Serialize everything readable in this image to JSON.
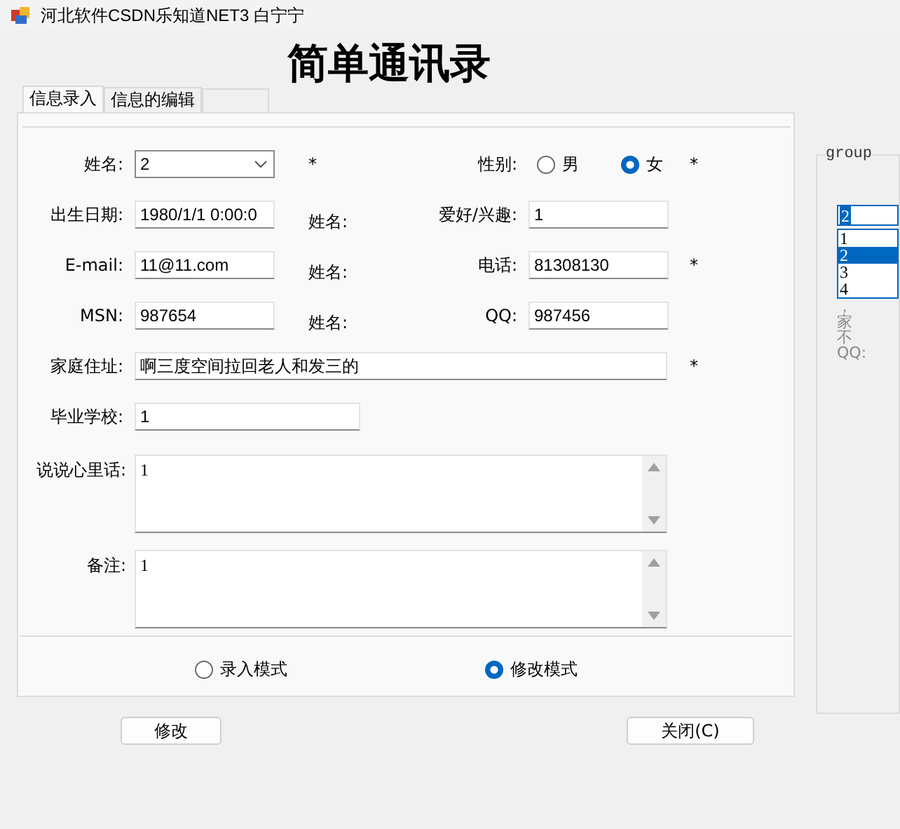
{
  "window": {
    "title": "河北软件CSDN乐知道NET3 白宁宁"
  },
  "heading": "简单通讯录",
  "tabs": [
    {
      "label": "信息录入",
      "selected": true
    },
    {
      "label": "信息的编辑",
      "selected": false
    }
  ],
  "form": {
    "rows": [
      {
        "items": [
          {
            "kind": "label",
            "text": "姓名:"
          },
          {
            "kind": "combo",
            "value": "2"
          },
          {
            "kind": "mark",
            "text": "*"
          },
          {
            "kind": "label",
            "text": "性别:"
          },
          {
            "kind": "radios",
            "options": [
              {
                "label": "男",
                "selected": false
              },
              {
                "label": "女",
                "selected": true
              }
            ]
          },
          {
            "kind": "mark",
            "text": "*"
          }
        ]
      },
      {
        "items": [
          {
            "kind": "label",
            "text": "出生日期:"
          },
          {
            "kind": "text",
            "value": "1980/1/1 0:00:0"
          },
          {
            "kind": "note",
            "text": "姓名:"
          },
          {
            "kind": "label",
            "text": "爱好/兴趣:"
          },
          {
            "kind": "text",
            "value": "1"
          }
        ]
      },
      {
        "items": [
          {
            "kind": "label",
            "text": "E-mail:"
          },
          {
            "kind": "text",
            "value": "11@11.com"
          },
          {
            "kind": "note",
            "text": "姓名:"
          },
          {
            "kind": "label",
            "text": "电话:"
          },
          {
            "kind": "text",
            "value": "81308130"
          },
          {
            "kind": "mark",
            "text": "*"
          }
        ]
      },
      {
        "items": [
          {
            "kind": "label",
            "text": "MSN:"
          },
          {
            "kind": "text",
            "value": "987654"
          },
          {
            "kind": "note",
            "text": "姓名:"
          },
          {
            "kind": "label",
            "text": "QQ:"
          },
          {
            "kind": "text",
            "value": "987456"
          }
        ]
      },
      {
        "items": [
          {
            "kind": "label",
            "text": "家庭住址:"
          },
          {
            "kind": "wide_text",
            "value": "啊三度空间拉回老人和发三的"
          },
          {
            "kind": "mark",
            "text": "*"
          }
        ]
      },
      {
        "items": [
          {
            "kind": "label",
            "text": "毕业学校:"
          },
          {
            "kind": "medium_text",
            "value": "1"
          }
        ]
      },
      {
        "items": [
          {
            "kind": "label",
            "text": "说说心里话:"
          },
          {
            "kind": "textarea",
            "value": "1"
          }
        ]
      },
      {
        "items": [
          {
            "kind": "label",
            "text": "备注:"
          },
          {
            "kind": "textarea",
            "value": "1"
          }
        ]
      }
    ],
    "modes": [
      {
        "label": "录入模式",
        "selected": false
      },
      {
        "label": "修改模式",
        "selected": true
      }
    ]
  },
  "buttons": [
    "修改",
    "关闭(C)"
  ],
  "group": {
    "title": "group",
    "value": "2",
    "items": [
      {
        "label": "1",
        "selected": false
      },
      {
        "label": "2",
        "selected": true
      },
      {
        "label": "3",
        "selected": false
      },
      {
        "label": "4",
        "selected": false
      }
    ],
    "fragments": [
      "，",
      "家",
      "不",
      "QQ:"
    ]
  }
}
